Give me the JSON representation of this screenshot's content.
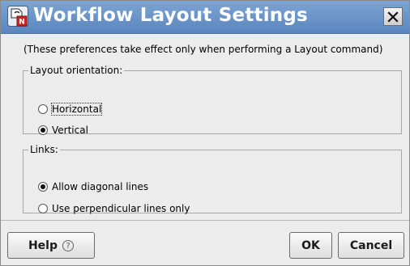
{
  "window": {
    "title": "Workflow Layout Settings",
    "app_icon": "workflow-app-icon",
    "close_icon": "close-icon"
  },
  "hint": "(These preferences take effect only when performing a Layout command)",
  "orientation": {
    "legend": "Layout orientation:",
    "options": [
      {
        "label": "Horizontal",
        "checked": false,
        "focused": true
      },
      {
        "label": "Vertical",
        "checked": true,
        "focused": false
      }
    ]
  },
  "links": {
    "legend": "Links:",
    "options": [
      {
        "label": "Allow diagonal lines",
        "checked": true
      },
      {
        "label": "Use perpendicular lines only",
        "checked": false
      }
    ]
  },
  "buttons": {
    "help": "Help",
    "help_icon": "question-circle-icon",
    "ok": "OK",
    "cancel": "Cancel"
  },
  "colors": {
    "titlebar": "#5a86bd",
    "dialog_bg": "#ececec"
  }
}
